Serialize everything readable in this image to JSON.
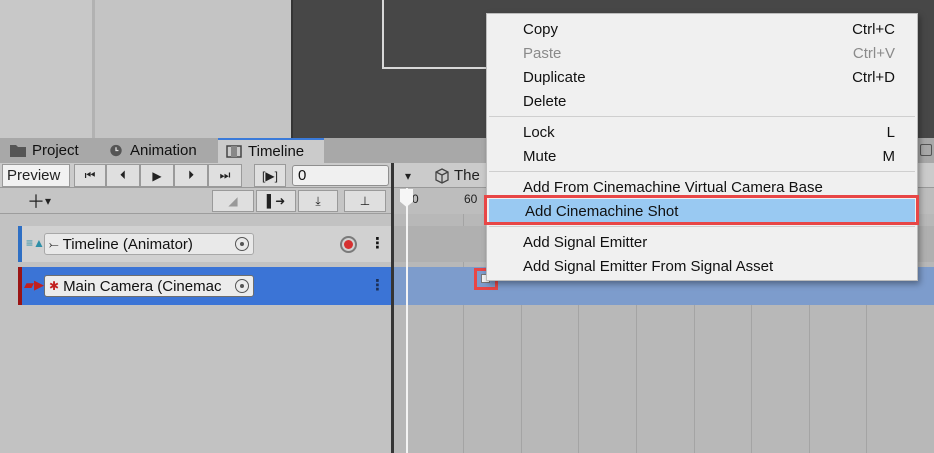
{
  "tabs": [
    {
      "label": "Project",
      "icon": "folder-icon"
    },
    {
      "label": "Animation",
      "icon": "clock-icon"
    },
    {
      "label": "Timeline",
      "icon": "film-icon"
    }
  ],
  "toolbar": {
    "preview_label": "Preview",
    "frame_value": "0",
    "asset_label": "The"
  },
  "ruler": {
    "labels": [
      "0",
      "60"
    ]
  },
  "tracks": [
    {
      "label": "Timeline (Animator)",
      "icon": "animator-icon",
      "color": "#2e6fc4"
    },
    {
      "label": "Main Camera (Cinemac",
      "icon": "camera-icon",
      "color": "#9a1414"
    }
  ],
  "menu": {
    "items": [
      {
        "label": "Copy",
        "shortcut": "Ctrl+C",
        "disabled": false
      },
      {
        "label": "Paste",
        "shortcut": "Ctrl+V",
        "disabled": true
      },
      {
        "label": "Duplicate",
        "shortcut": "Ctrl+D",
        "disabled": false
      },
      {
        "label": "Delete",
        "shortcut": "",
        "disabled": false
      },
      {
        "label": "Lock",
        "shortcut": "L",
        "disabled": false
      },
      {
        "label": "Mute",
        "shortcut": "M",
        "disabled": false
      },
      {
        "label": "Add From Cinemachine Virtual Camera Base",
        "shortcut": "",
        "disabled": false
      },
      {
        "label": "Add Cinemachine Shot",
        "shortcut": "",
        "disabled": false
      },
      {
        "label": "Add Signal Emitter",
        "shortcut": "",
        "disabled": false
      },
      {
        "label": "Add Signal Emitter From Signal Asset",
        "shortcut": "",
        "disabled": false
      }
    ],
    "highlight_color": "#99c9f2",
    "annotation_color": "#e84646"
  }
}
